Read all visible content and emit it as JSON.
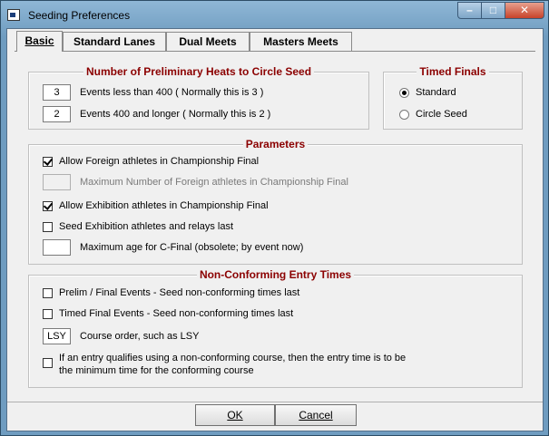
{
  "window": {
    "title": "Seeding Preferences"
  },
  "tabs": [
    {
      "label": "Basic",
      "active": true
    },
    {
      "label": "Standard Lanes",
      "active": false
    },
    {
      "label": "Dual Meets",
      "active": false
    },
    {
      "label": "Masters Meets",
      "active": false
    }
  ],
  "heats": {
    "title": "Number of Preliminary Heats to Circle Seed",
    "rows": [
      {
        "value": "3",
        "label": "Events less than 400 ( Normally this is 3 )"
      },
      {
        "value": "2",
        "label": "Events 400 and longer ( Normally this is 2 )"
      }
    ]
  },
  "timed_finals": {
    "title": "Timed Finals",
    "options": [
      {
        "label": "Standard",
        "selected": true
      },
      {
        "label": "Circle Seed",
        "selected": false
      }
    ]
  },
  "parameters": {
    "title": "Parameters",
    "allow_foreign": "Allow Foreign athletes in Championship Final",
    "max_foreign_value": "",
    "max_foreign": "Maximum Number of Foreign athletes in Championship Final",
    "allow_exhibition": "Allow Exhibition athletes in Championship Final",
    "seed_exhibition": "Seed Exhibition athletes and relays last",
    "max_age_value": "",
    "max_age": "Maximum age for C-Final (obsolete; by event now)"
  },
  "nonconforming": {
    "title": "Non-Conforming Entry Times",
    "prelim_final": "Prelim / Final Events - Seed non-conforming times last",
    "timed_final": "Timed Final Events - Seed non-conforming times last",
    "course_value": "LSY",
    "course_order": "Course order, such as LSY",
    "qualify_line1": "If an entry qualifies using a non-conforming course, then the entry time is to be",
    "qualify_line2": "the minimum time for the conforming course"
  },
  "buttons": {
    "ok": "OK",
    "cancel": "Cancel"
  }
}
